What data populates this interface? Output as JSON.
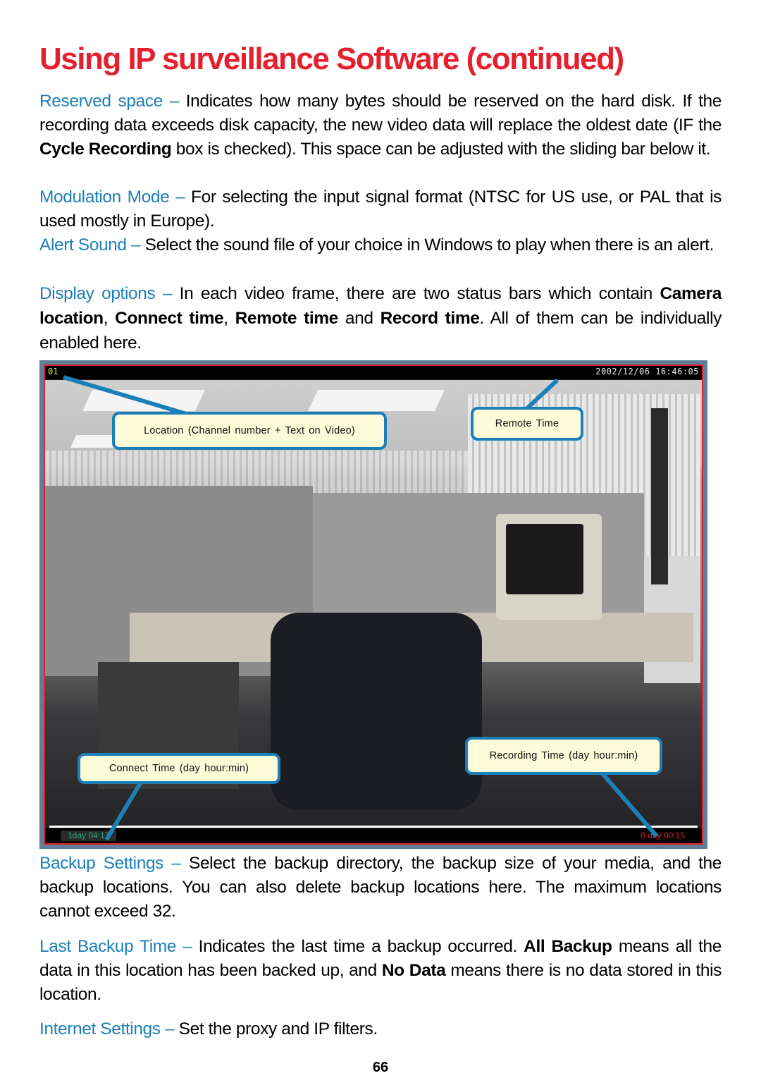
{
  "title": "Using IP surveillance Software (continued)",
  "sections_top": [
    {
      "term": "Reserved space –",
      "text_parts": [
        " Indicates how many bytes should be reserved on the hard disk. If the recording data exceeds disk capacity, the new video data will replace the oldest date (IF the ",
        "Cycle Recording",
        " box is checked). This space can be adjusted with the sliding bar below it."
      ]
    },
    {
      "term": "Modulation Mode –",
      "text": " For selecting the input signal format (NTSC for US use, or PAL that is used mostly in Europe)."
    },
    {
      "term": "Alert Sound –",
      "text": " Select the sound file of your choice in Windows to play when there is an alert."
    },
    {
      "term": "Display options –",
      "text_parts": [
        " In each video frame, there are two status bars which contain ",
        "Camera location",
        ", ",
        "Connect time",
        ", ",
        "Remote time",
        " and ",
        "Record time",
        ". All of them can be  individually enabled here."
      ]
    }
  ],
  "screenshot": {
    "channel": "01",
    "remote_timestamp": "2002/12/06 16:46:05",
    "connect_time": "1day  04:17",
    "record_time": "0 day  00:15",
    "callouts": {
      "location": "Location (Channel number + Text on Video)",
      "remote_time": "Remote Time",
      "connect_time": "Connect Time (day hour:min)",
      "recording_time": "Recording Time (day hour:min)"
    },
    "colors": {
      "callout_border": "#1c7fb8",
      "callout_fill": "#fdfbd8",
      "frame_border": "#e5202e",
      "channel_text": "#e8e24a",
      "connect_time_text": "#2aa77a",
      "record_time_text": "#e5202e"
    }
  },
  "sections_bottom": [
    {
      "term": "Backup Settings –",
      "text": " Select the backup directory, the backup size of your  media, and the backup locations. You can also delete backup locations here. The maximum locations cannot exceed 32."
    },
    {
      "term": "Last Backup Time –",
      "text_parts": [
        " Indicates the last time a backup occurred. ",
        "All Backup",
        " means all the data in this location has been backed up, and ",
        "No Data",
        " means there is no data stored in this location."
      ]
    },
    {
      "term": "Internet Settings –",
      "text": " Set the proxy and IP filters."
    }
  ],
  "page_number": "66",
  "colors": {
    "title": "#e5202e",
    "term": "#1c7fb8",
    "body_text": "#000000"
  }
}
